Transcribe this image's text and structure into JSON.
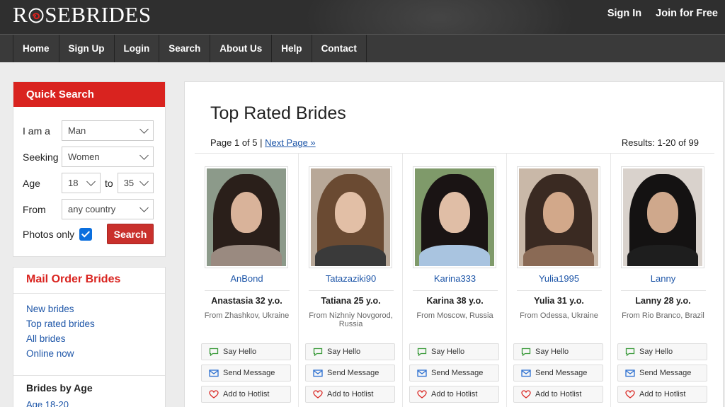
{
  "header": {
    "logo": "ROSEBRIDES",
    "logo_left": "R",
    "logo_right": "SEBRIDES",
    "sign_in": "Sign In",
    "join": "Join for Free"
  },
  "nav": [
    "Home",
    "Sign Up",
    "Login",
    "Search",
    "About Us",
    "Help",
    "Contact"
  ],
  "quick_search": {
    "title": "Quick Search",
    "i_am_label": "I am a",
    "i_am_value": "Man",
    "seeking_label": "Seeking",
    "seeking_value": "Women",
    "age_label": "Age",
    "age_from": "18",
    "age_to_label": "to",
    "age_to": "35",
    "from_label": "From",
    "from_value": "any country",
    "photos_only_label": "Photos only",
    "photos_only_checked": true,
    "search_button": "Search"
  },
  "mail_order": {
    "title": "Mail Order Brides",
    "links": [
      "New brides",
      "Top rated brides",
      "All brides",
      "Online now"
    ],
    "section": "Brides by Age",
    "section_link": "Age 18-20"
  },
  "main": {
    "title": "Top Rated Brides",
    "page_text": "Page 1 of 5 | ",
    "next_page": "Next Page »",
    "results": "Results: 1-20 of 99"
  },
  "actions": {
    "say_hello": "Say Hello",
    "send_message": "Send Message",
    "add_hotlist": "Add to Hotlist"
  },
  "profiles": [
    {
      "username": "AnBond",
      "name_age": "Anastasia 32 y.o.",
      "from": "From Zhashkov, Ukraine"
    },
    {
      "username": "Tatazaziki90",
      "name_age": "Tatiana 25 y.o.",
      "from": "From Nizhniy Novgorod, Russia"
    },
    {
      "username": "Karina333",
      "name_age": "Karina 38 y.o.",
      "from": "From Moscow, Russia"
    },
    {
      "username": "Yulia1995",
      "name_age": "Yulia 31 y.o.",
      "from": "From Odessa, Ukraine"
    },
    {
      "username": "Lanny",
      "name_age": "Lanny 28 y.o.",
      "from": "From Rio Branco, Brazil"
    }
  ],
  "colors": {
    "accent": "#d9231f",
    "link": "#1e56a8",
    "checkbox": "#0b6fde"
  }
}
